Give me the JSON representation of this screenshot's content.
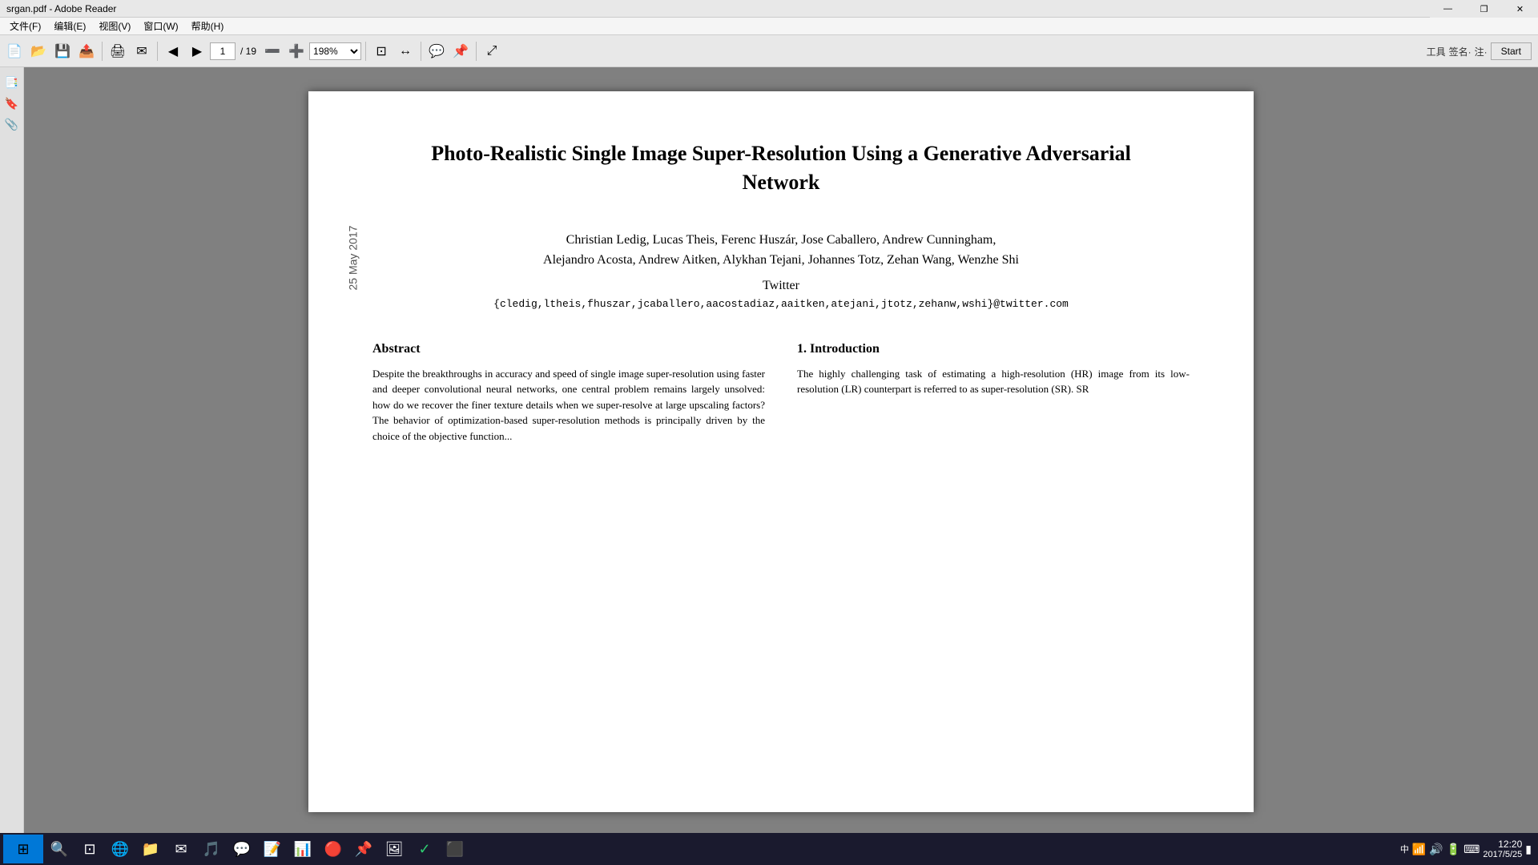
{
  "window": {
    "title": "srgan.pdf - Adobe Reader",
    "min_btn": "—",
    "max_btn": "❐",
    "close_btn": "✕"
  },
  "menu": {
    "items": [
      "文件(F)",
      "编辑(E)",
      "视图(V)",
      "窗口(W)",
      "帮助(H)"
    ]
  },
  "toolbar": {
    "page_current": "1",
    "page_total": "/ 19",
    "zoom_value": "198%",
    "right_label": "工具",
    "right_label2": "签名·",
    "right_label3": "注·",
    "start_btn": "Start"
  },
  "pdf": {
    "date_stamp": "25 May 2017",
    "title_line1": "Photo-Realistic Single Image Super-Resolution Using a Generative Adversarial",
    "title_line2": "Network",
    "authors_line1": "Christian Ledig, Lucas Theis, Ferenc Huszár, Jose Caballero, Andrew Cunningham,",
    "authors_line2": "Alejandro Acosta, Andrew Aitken, Alykhan Tejani, Johannes Totz, Zehan Wang, Wenzhe Shi",
    "affiliation": "Twitter",
    "email": "{cledig,ltheis,fhuszar,jcaballero,aacostadiaz,aaitken,atejani,jtotz,zehanw,wshi}@twitter.com",
    "abstract_heading": "Abstract",
    "abstract_text": "",
    "intro_heading": "1. Introduction",
    "intro_text": "The highly challenging task of estimating a high-resolution (HR) image from its low-resolution (LR) counterpart is referred to as super-resolution (SR). SR"
  },
  "taskbar": {
    "time": "12:20",
    "icons": [
      "⊞",
      "🗂",
      "🌐",
      "📁",
      "📧",
      "🎵",
      "💬",
      "📝",
      "📊",
      "🔴",
      "📌",
      "🖼"
    ]
  }
}
